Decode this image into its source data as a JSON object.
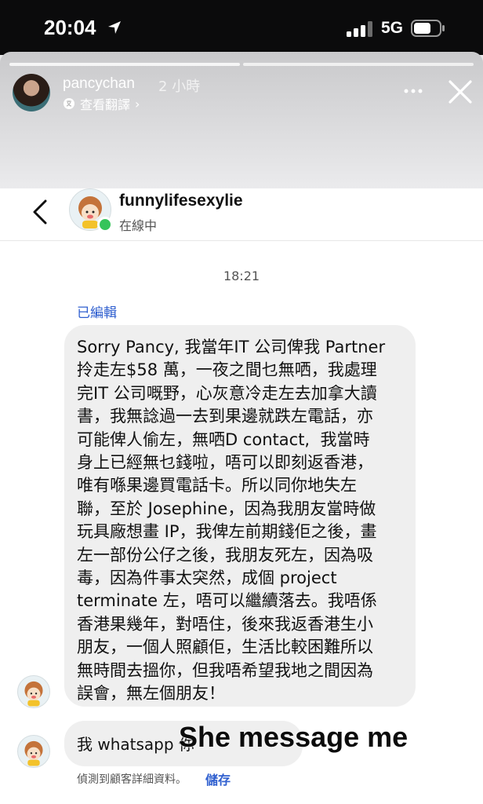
{
  "status_bar": {
    "time": "20:04",
    "network": "5G"
  },
  "story": {
    "username": "pancychan",
    "age": "2 小時",
    "translate_label": "查看翻譯",
    "translate_chevron": "›"
  },
  "chat": {
    "username": "funnylifesexylie",
    "status": "在線中",
    "timestamp": "18:21",
    "edited_label": "已編輯",
    "message": "Sorry Pancy, 我當年IT 公司俾我 Partner\n拎走左$58 萬，一夜之間乜無哂，我處理\n完IT 公司嘅野，心灰意冷走左去加拿大讀\n書，我無諗過一去到果邊就跌左電話，亦\n可能俾人偷左，無哂D contact,  我當時\n身上已經無乜錢啦，唔可以即刻返香港，\n唯有喺果邊買電話卡。所以同你地失左\n聯，至於 Josephine，因為我朋友當時做\n玩具廠想畫 IP，我俾左前期錢佢之後，畫\n左一部份公仔之後，我朋友死左，因為吸\n毒，因為件事太突然，成個 project\nterminate 左，唔可以繼續落去。我唔係\n香港果幾年，對唔住，後來我返香港生小\n朋友，一個人照顧佢，生活比較困難所以\n無時間去搵你，但我唔希望我地之間因為\n誤會，無左個朋友！",
    "message2": "我 whatsapp 你",
    "detected_note": "偵測到顧客詳細資料。",
    "save_label": "儲存"
  },
  "overlay_caption": "She message me",
  "colors": {
    "link": "#2f5fcf",
    "online": "#36c45a",
    "bubble": "#efefef"
  }
}
